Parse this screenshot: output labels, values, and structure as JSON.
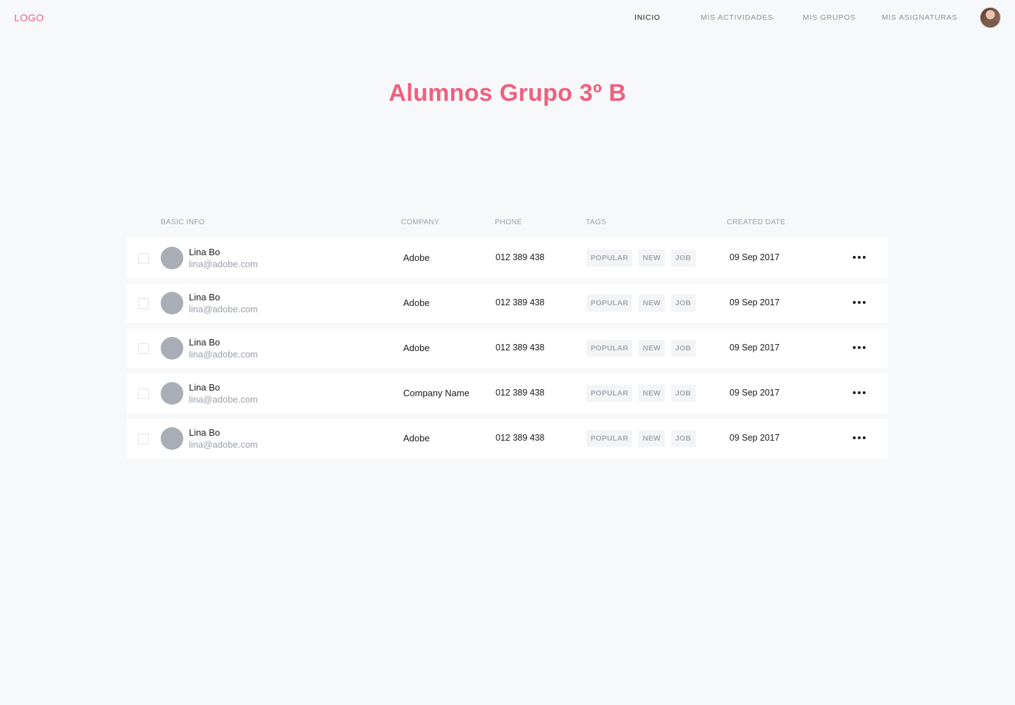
{
  "header": {
    "logo": "LOGO",
    "nav": [
      {
        "label": "INICIO",
        "active": true
      },
      {
        "label": "MIS ACTIVIDADES",
        "active": false
      },
      {
        "label": "MIS GRUPOS",
        "active": false
      },
      {
        "label": "MIS ASIGNATURAS",
        "active": false
      }
    ],
    "avatar_icon": "user-avatar"
  },
  "page": {
    "title": "Alumnos Grupo 3º B"
  },
  "table": {
    "columns": [
      "BASIC INFO",
      "COMPANY",
      "PHONE",
      "TAGS",
      "CREATED DATE"
    ],
    "rows": [
      {
        "name": "Lina Bo",
        "email": "lina@adobe.com",
        "company": "Adobe",
        "phone": "012 389 438",
        "tags": [
          "POPULAR",
          "NEW",
          "JOB"
        ],
        "date": "09 Sep 2017"
      },
      {
        "name": "Lina Bo",
        "email": "lina@adobe.com",
        "company": "Adobe",
        "phone": "012 389 438",
        "tags": [
          "POPULAR",
          "NEW",
          "JOB"
        ],
        "date": "09 Sep 2017"
      },
      {
        "name": "Lina Bo",
        "email": "lina@adobe.com",
        "company": "Adobe",
        "phone": "012 389 438",
        "tags": [
          "POPULAR",
          "NEW",
          "JOB"
        ],
        "date": "09 Sep 2017"
      },
      {
        "name": "Lina Bo",
        "email": "lina@adobe.com",
        "company": "Company Name",
        "phone": "012 389 438",
        "tags": [
          "POPULAR",
          "NEW",
          "JOB"
        ],
        "date": "09 Sep 2017"
      },
      {
        "name": "Lina Bo",
        "email": "lina@adobe.com",
        "company": "Adobe",
        "phone": "012 389 438",
        "tags": [
          "POPULAR",
          "NEW",
          "JOB"
        ],
        "date": "09 Sep 2017"
      }
    ]
  },
  "colors": {
    "accent": "#f0607e",
    "background": "#f7f8fa",
    "muted": "#9aa0aa"
  }
}
